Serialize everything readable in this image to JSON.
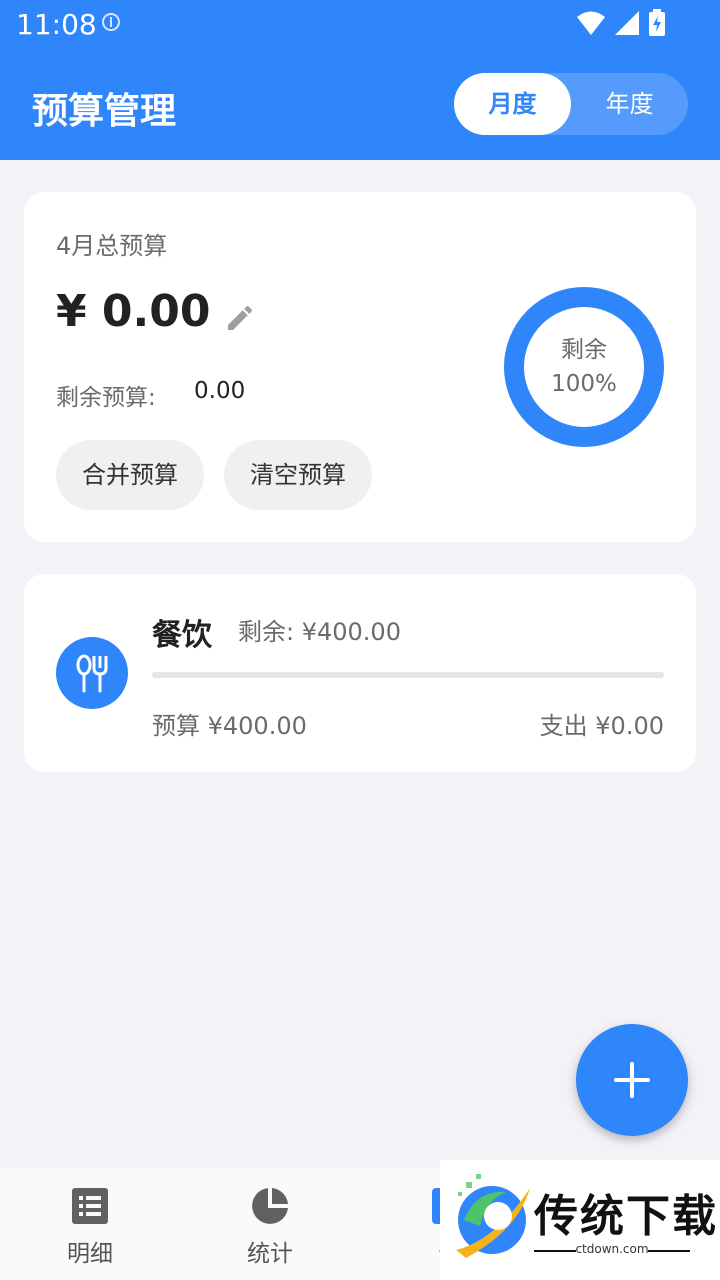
{
  "status_bar": {
    "time": "11:08"
  },
  "header": {
    "title": "预算管理",
    "toggle": {
      "month": "月度",
      "year": "年度",
      "selected": "月度"
    }
  },
  "summary": {
    "month_label": "4月总预算",
    "amount": "¥ 0.00",
    "remaining_label": "剩余预算:",
    "remaining_value": "0.00",
    "merge_button": "合并预算",
    "clear_button": "清空预算",
    "ring": {
      "label": "剩余",
      "percent_text": "100%",
      "fraction": 1.0
    }
  },
  "categories": [
    {
      "name": "餐饮",
      "remaining": "剩余: ¥400.00",
      "budget": "预算 ¥400.00",
      "spent": "支出 ¥0.00",
      "progress": 0.0,
      "icon": "utensils-icon"
    }
  ],
  "fab": {
    "icon": "plus-icon"
  },
  "bottom_nav": [
    {
      "label": "明细",
      "icon": "list-icon"
    },
    {
      "label": "统计",
      "icon": "pie-chart-icon"
    },
    {
      "label": "预",
      "icon": "budget-icon"
    }
  ],
  "watermark": {
    "text": "传统下载",
    "sub": "ctdown.com"
  },
  "colors": {
    "accent": "#2f86fa",
    "background": "#f2f2f7"
  }
}
